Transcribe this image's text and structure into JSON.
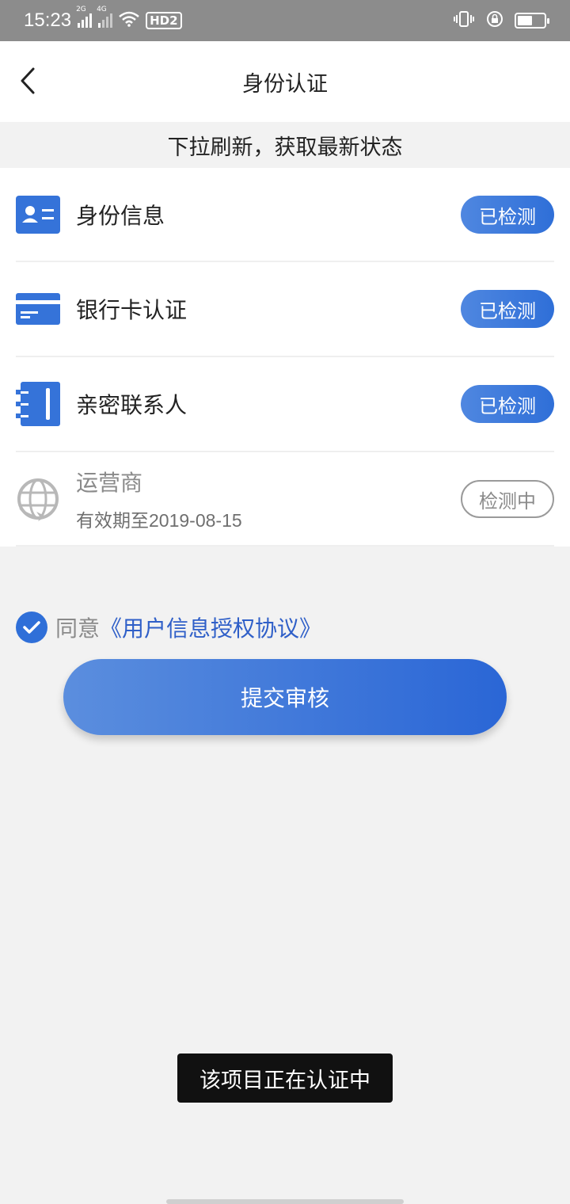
{
  "status_bar": {
    "time": "15:23",
    "net1": "2G",
    "net2": "4G",
    "hd": "HD2"
  },
  "header": {
    "title": "身份认证",
    "back_icon": "chevron-left-icon"
  },
  "banner": {
    "text": "下拉刷新，获取最新状态"
  },
  "items": [
    {
      "label": "身份信息",
      "status": "已检测",
      "icon": "id-card-icon",
      "state": "done"
    },
    {
      "label": "银行卡认证",
      "status": "已检测",
      "icon": "bank-card-icon",
      "state": "done"
    },
    {
      "label": "亲密联系人",
      "status": "已检测",
      "icon": "contact-book-icon",
      "state": "done"
    },
    {
      "label": "运营商",
      "sub": "有效期至2019-08-15",
      "status": "检测中",
      "icon": "globe-refresh-icon",
      "state": "pending"
    }
  ],
  "agreement": {
    "prefix": "同意",
    "link": "《用户信息授权协议》",
    "checked": true
  },
  "submit": {
    "label": "提交审核"
  },
  "toast": {
    "text": "该项目正在认证中"
  },
  "colors": {
    "accent": "#2f6fd8",
    "badge_gradient_start": "#4f87e0",
    "badge_gradient_end": "#2f6fd8",
    "status_bar": "#8c8c8c",
    "background": "#f2f2f2"
  }
}
